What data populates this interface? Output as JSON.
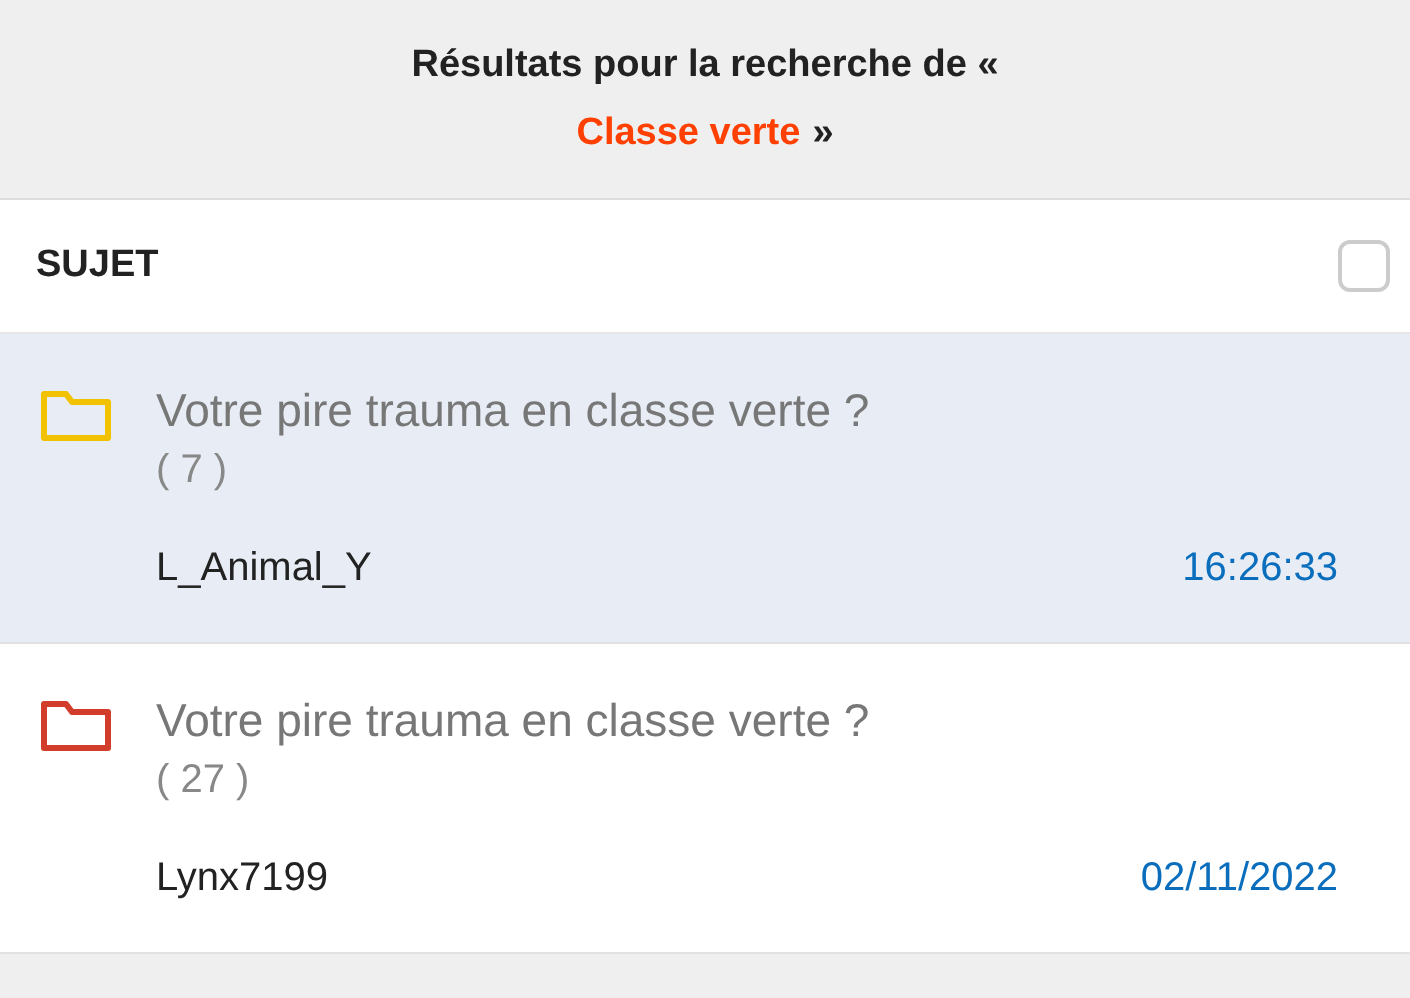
{
  "header": {
    "prefix": "Résultats pour la recherche de «",
    "query": "Classe verte",
    "suffix": "»"
  },
  "list_header": {
    "label": "SUJET",
    "checked": false
  },
  "topics": [
    {
      "title": "Votre pire trauma en classe verte ?",
      "count": "( 7 )",
      "author": "L_Animal_Y",
      "date": "16:26:33",
      "color": "#f2c200",
      "selected": true
    },
    {
      "title": "Votre pire trauma en classe verte ?",
      "count": "( 27 )",
      "author": "Lynx7199",
      "date": "02/11/2022",
      "color": "#d23c2a",
      "selected": false
    }
  ]
}
